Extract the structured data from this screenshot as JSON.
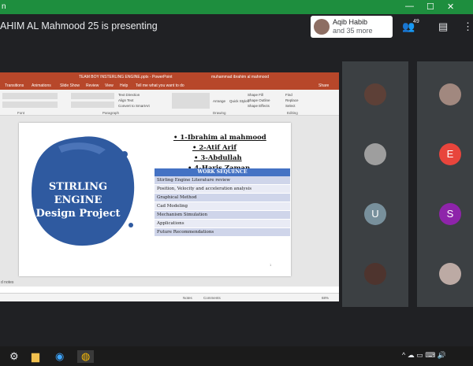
{
  "top_strip": {
    "text": "n",
    "controls": [
      "—",
      "☐",
      "✕"
    ]
  },
  "presenter_text": "AHIM AL Mahmood 25 is presenting",
  "participant_card": {
    "name": "Aqib Habib",
    "more": "and 35 more"
  },
  "header": {
    "people_count": "49",
    "people_icon": "people-icon",
    "chat_icon": "chat-icon",
    "info_icon": "info-icon"
  },
  "ppt": {
    "window_title": "TEAM BOY INSTERLING ENGINE.pptx - PowerPoint",
    "user": "muhammad ibrahim al mahmood",
    "tabs": [
      "Transitions",
      "Animations",
      "Slide Show",
      "Review",
      "View",
      "Help",
      "Tell me what you want to do",
      "Share"
    ],
    "ribbon_groups": [
      "Font",
      "Paragraph",
      "Drawing",
      "Editing"
    ],
    "ribbon_items": {
      "text_direction": "Text Direction",
      "align_text": "Align Text",
      "convert_smartart": "Convert to SmartArt",
      "arrange": "Arrange",
      "quick_styles": "Quick Styles",
      "shape_fill": "Shape Fill",
      "shape_outline": "Shape Outline",
      "shape_effects": "Shape Effects",
      "find": "Find",
      "replace": "Replace",
      "select": "Select"
    },
    "notes": "d notes",
    "status": {
      "notes": "Notes",
      "comments": "Comments",
      "zoom": "68%"
    }
  },
  "slide": {
    "title_lines": [
      "STIRLING",
      "ENGINE",
      "Design Project"
    ],
    "names": [
      "• 1-Ibrahim al mahmood",
      "• 2-Atif Arif",
      "• 3-Abdullah",
      "• 4-Haris Zaman"
    ],
    "table_header": "WORK SEQUENCE",
    "rows": [
      "Stirling Engine Literature review",
      "Position, Velocity and acceleration analysis",
      "Graphical Method",
      "Cad Modeling",
      "Mechanism Simulation",
      "Applications",
      "Future Recommendations"
    ],
    "page_num": "1"
  },
  "tiles": [
    {
      "label": "",
      "color": "#5d4037",
      "kind": "photo"
    },
    {
      "label": "",
      "color": "#a1887f",
      "kind": "photo"
    },
    {
      "label": "",
      "color": "#9e9e9e",
      "kind": "photo"
    },
    {
      "label": "E",
      "color": "#e8453c",
      "kind": "letter"
    },
    {
      "label": "U",
      "color": "#78909c",
      "kind": "letter"
    },
    {
      "label": "S",
      "color": "#8e24aa",
      "kind": "letter"
    },
    {
      "label": "",
      "color": "#4e342e",
      "kind": "photo"
    },
    {
      "label": "",
      "color": "#bcaaa4",
      "kind": "photo"
    }
  ],
  "taskbar": {
    "icons": [
      "settings-icon",
      "file-explorer-icon",
      "edge-icon",
      "chrome-icon"
    ],
    "tray": "^  ☁  ▭  ⌨  🔊"
  }
}
